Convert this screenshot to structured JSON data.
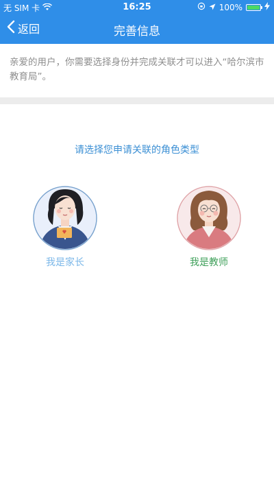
{
  "status_bar": {
    "carrier": "无 SIM 卡",
    "time": "16:25",
    "battery": "100%"
  },
  "nav": {
    "back_label": "返回",
    "title": "完善信息"
  },
  "notice": {
    "text": "亲爱的用户，你需要选择身份并完成关联才可以进入“哈尔滨市教育局”。"
  },
  "prompt": "请选择您申请关联的角色类型",
  "roles": [
    {
      "label": "我是家长",
      "icon": "parent-avatar-icon"
    },
    {
      "label": "我是教师",
      "icon": "teacher-avatar-icon"
    }
  ],
  "colors": {
    "primary": "#2f8ee8",
    "prompt": "#3b8fd4",
    "parent_label": "#7bb7e8",
    "teacher_label": "#3fa05a"
  }
}
